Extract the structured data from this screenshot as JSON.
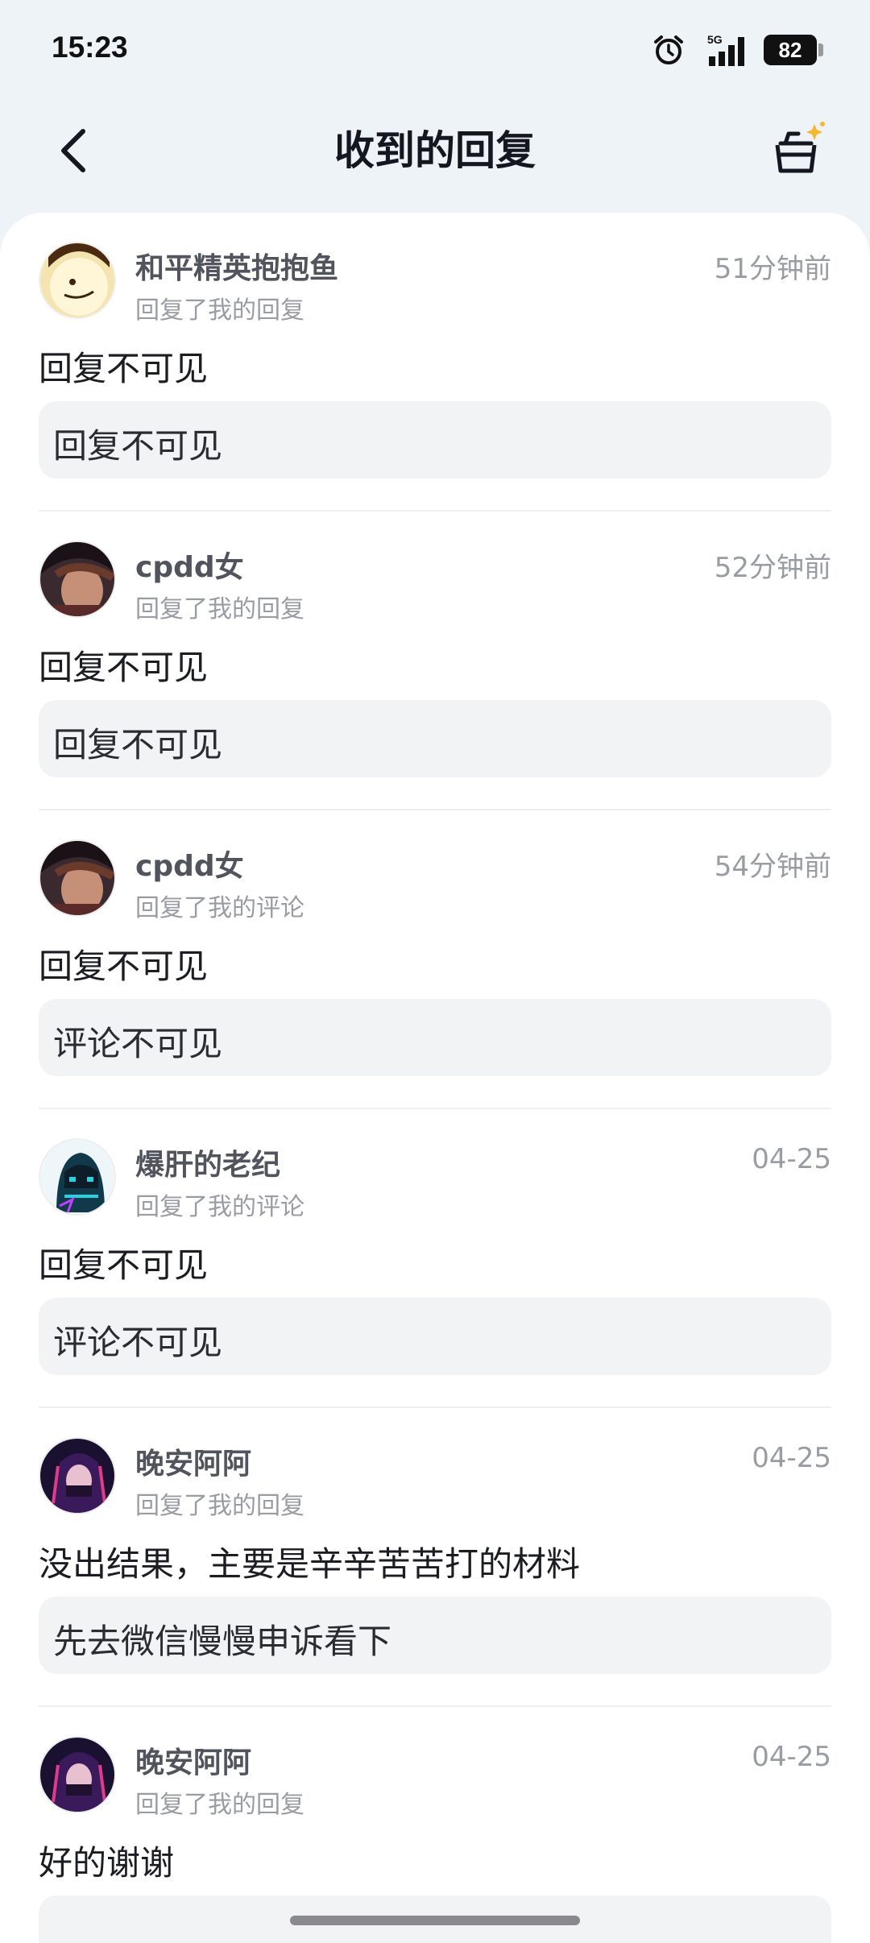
{
  "status_bar": {
    "time": "15:23",
    "network": "5G",
    "battery": "82",
    "icons": [
      "alarm-icon",
      "signal-icon",
      "battery-icon"
    ]
  },
  "header": {
    "title": "收到的回复",
    "back_icon": "chevron-left-icon",
    "action_icon": "basket-sparkle-icon"
  },
  "replies": [
    {
      "username": "和平精英抱抱鱼",
      "action": "回复了我的回复",
      "time": "51分钟前",
      "reply": "回复不可见",
      "quote": "回复不可见"
    },
    {
      "username": "cpdd女",
      "action": "回复了我的回复",
      "time": "52分钟前",
      "reply": "回复不可见",
      "quote": "回复不可见"
    },
    {
      "username": "cpdd女",
      "action": "回复了我的评论",
      "time": "54分钟前",
      "reply": "回复不可见",
      "quote": "评论不可见"
    },
    {
      "username": "爆肝的老纪",
      "action": "回复了我的评论",
      "time": "04-25",
      "reply": "回复不可见",
      "quote": "评论不可见"
    },
    {
      "username": "晚安阿阿",
      "action": "回复了我的回复",
      "time": "04-25",
      "reply": "没出结果，主要是辛辛苦苦打的材料",
      "quote": "先去微信慢慢申诉看下"
    },
    {
      "username": "晚安阿阿",
      "action": "回复了我的回复",
      "time": "04-25",
      "reply": "好的谢谢",
      "quote": ""
    }
  ],
  "colors": {
    "background": "#eef3f7",
    "card": "#ffffff",
    "quote_bg": "#f2f3f5",
    "muted": "#9a9ca3",
    "accent_star": "#f5b82e"
  }
}
